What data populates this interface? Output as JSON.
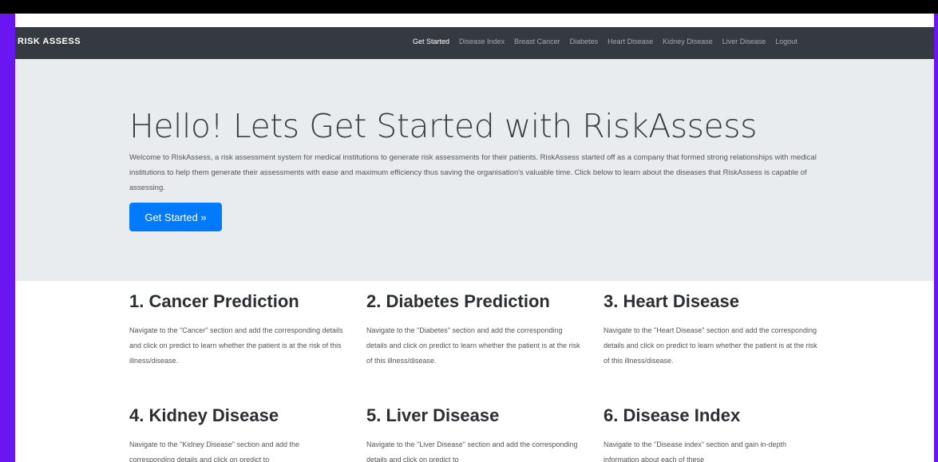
{
  "navbar": {
    "brand": "RISK ASSESS",
    "items": [
      "Get Started",
      "Disease Index",
      "Breast Cancer",
      "Diabetes",
      "Heart Disease",
      "Kidney Disease",
      "Liver Disease",
      "Logout"
    ]
  },
  "jumbotron": {
    "title": "Hello! Lets Get Started with RiskAssess",
    "text": "Welcome to RiskAssess, a risk assessment system for medical institutions to generate risk assessments for their patients. RiskAssess started off as a company that formed strong relationships with medical institutions to help them generate their assessments with ease and maximum efficiency thus saving the organisation's valuable time. Click below to learn about the diseases that RiskAssess is capable of assessing.",
    "button": "Get Started »"
  },
  "cards": [
    {
      "title": "1. Cancer Prediction",
      "text": "Navigate to the \"Cancer\" section and add the corresponding details and click on predict to learn whether the patient is at the risk of this illness/disease."
    },
    {
      "title": "2. Diabetes Prediction",
      "text": "Navigate to the \"Diabetes\" section and add the corresponding details and click on predict to learn whether the patient is at the risk of this illness/disease."
    },
    {
      "title": "3. Heart Disease",
      "text": "Navigate to the \"Heart Disease\" section and add the corresponding details and click on predict to learn whether the patient is at the risk of this illness/disease."
    },
    {
      "title": "4. Kidney Disease",
      "text": "Navigate to the \"Kidney Disease\" section and add the corresponding details and click on predict to"
    },
    {
      "title": "5. Liver Disease",
      "text": "Navigate to the \"Liver Disease\" section and add the corresponding details and click on predict to"
    },
    {
      "title": "6. Disease Index",
      "text": "Navigate to the \"Disease index\" section and gain in-depth information about each of these"
    }
  ]
}
